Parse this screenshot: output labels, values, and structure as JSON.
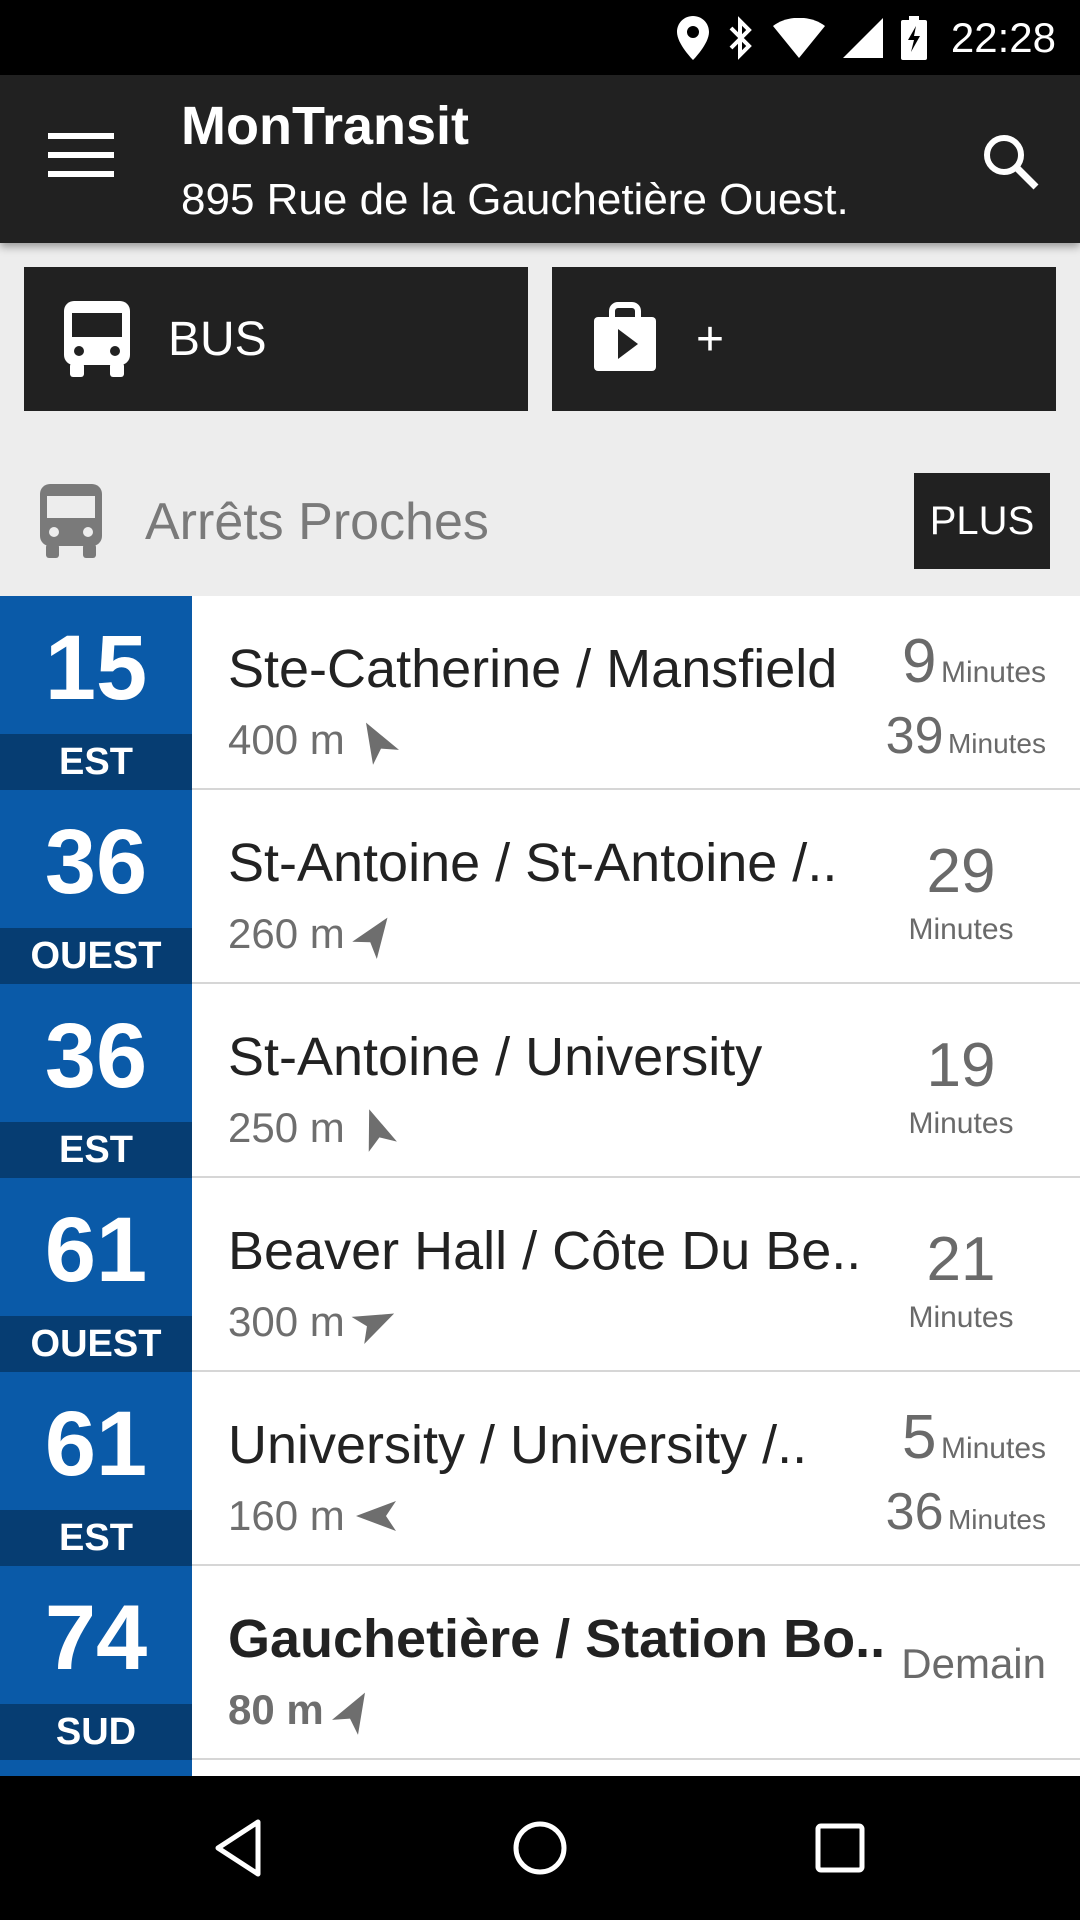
{
  "status": {
    "time": "22:28"
  },
  "appbar": {
    "title": "MonTransit",
    "subtitle": "895 Rue de la Gauchetière Ouest."
  },
  "agencies": [
    {
      "label": "BUS"
    },
    {
      "label": "+"
    }
  ],
  "section": {
    "title": "Arrêts Proches",
    "more_label": "PLUS"
  },
  "stops": [
    {
      "route": "15",
      "direction": "EST",
      "name": "Ste-Catherine / Mansfield",
      "distance": "400 m",
      "t1": "9",
      "t1_unit": "Minutes",
      "t2": "39",
      "t2_unit": "Minutes"
    },
    {
      "route": "36",
      "direction": "OUEST",
      "name": "St-Antoine / St-Antoine /..",
      "distance": "260 m",
      "t1": "29",
      "t1_unit": "Minutes"
    },
    {
      "route": "36",
      "direction": "EST",
      "name": "St-Antoine / University",
      "distance": "250 m",
      "t1": "19",
      "t1_unit": "Minutes"
    },
    {
      "route": "61",
      "direction": "OUEST",
      "name": "Beaver Hall / Côte Du Be..",
      "distance": "300 m",
      "t1": "21",
      "t1_unit": "Minutes"
    },
    {
      "route": "61",
      "direction": "EST",
      "name": "University / University /..",
      "distance": "160 m",
      "t1": "5",
      "t1_unit": "Minutes",
      "t2": "36",
      "t2_unit": "Minutes"
    },
    {
      "route": "74",
      "direction": "SUD",
      "name": "Gauchetière / Station Bo..",
      "distance": "80 m",
      "status": "Demain"
    }
  ],
  "colors": {
    "route_bg": "#0a5aa8",
    "direction_bg": "#063d72",
    "appbar": "#212121"
  }
}
